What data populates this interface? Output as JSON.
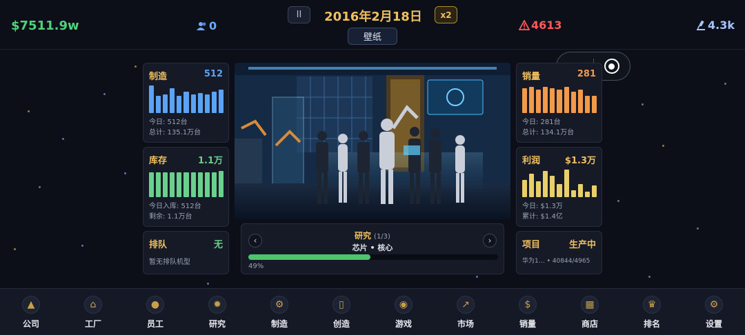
{
  "top": {
    "money": "$7511.9w",
    "staff": "0",
    "pause": "II",
    "date": "2016年2月18日",
    "speed": "x2",
    "wallpaper": "壁纸",
    "alerts": "4613",
    "fans": "4.3k"
  },
  "cards": {
    "make": {
      "title": "制造",
      "value": "512",
      "line1": "今日: 512台",
      "line2": "总计: 135.1万台",
      "color": "#5aa3f5",
      "bars": [
        0.95,
        0.6,
        0.65,
        0.85,
        0.6,
        0.75,
        0.65,
        0.7,
        0.65,
        0.75,
        0.8
      ]
    },
    "stock": {
      "title": "库存",
      "value": "1.1万",
      "line1": "今日入库: 512台",
      "line2": "剩余: 1.1万台",
      "color": "#6ad08e",
      "bars": [
        0.85,
        0.85,
        0.85,
        0.85,
        0.85,
        0.85,
        0.85,
        0.85,
        0.85,
        0.85,
        0.9
      ]
    },
    "queue": {
      "title": "排队",
      "value": "无",
      "line1": "暂无排队机型"
    },
    "sales": {
      "title": "销量",
      "value": "281",
      "line1": "今日: 281台",
      "line2": "总计: 134.1万台",
      "color": "#f29a4a",
      "bars": [
        0.85,
        0.9,
        0.8,
        0.9,
        0.85,
        0.8,
        0.9,
        0.75,
        0.8,
        0.6,
        0.6
      ]
    },
    "profit": {
      "title": "利润",
      "value": "$1.3万",
      "line1": "今日: $1.3万",
      "line2": "累计: $1.4亿",
      "color": "#e8cf6a",
      "bars": [
        0.6,
        0.8,
        0.55,
        0.9,
        0.75,
        0.45,
        0.95,
        0.25,
        0.45,
        0.2,
        0.4
      ]
    },
    "project": {
      "title": "项目",
      "value": "生产中",
      "line1": "华为1…  •  40844/4965"
    }
  },
  "research": {
    "title": "研究",
    "count": "(1/3)",
    "subtitle": "芯片 • 核心",
    "progress": 0.49,
    "percent": "49%"
  },
  "nav": [
    {
      "label": "公司",
      "icon": "company-icon",
      "glyph": "▲"
    },
    {
      "label": "工厂",
      "icon": "factory-icon",
      "glyph": "⌂"
    },
    {
      "label": "员工",
      "icon": "employee-icon",
      "glyph": "●"
    },
    {
      "label": "研究",
      "icon": "research-icon",
      "glyph": "✹"
    },
    {
      "label": "制造",
      "icon": "manufacture-icon",
      "glyph": "⚙"
    },
    {
      "label": "创造",
      "icon": "create-icon",
      "glyph": "▯"
    },
    {
      "label": "游戏",
      "icon": "game-icon",
      "glyph": "◉"
    },
    {
      "label": "市场",
      "icon": "market-icon",
      "glyph": "↗"
    },
    {
      "label": "销量",
      "icon": "sales-icon",
      "glyph": "$"
    },
    {
      "label": "商店",
      "icon": "shop-icon",
      "glyph": "▦"
    },
    {
      "label": "排名",
      "icon": "ranking-icon",
      "glyph": "♛"
    },
    {
      "label": "设置",
      "icon": "settings-icon",
      "glyph": "⚙"
    }
  ]
}
